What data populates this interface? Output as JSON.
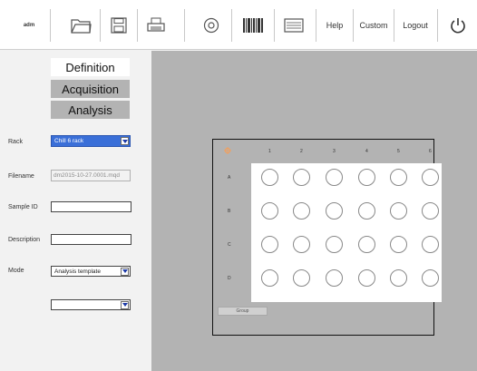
{
  "toolbar": {
    "user": "adm",
    "help_label": "Help",
    "custom_label": "Custom",
    "logout_label": "Logout",
    "icons": [
      "open-folder-icon",
      "save-icon",
      "print-icon",
      "target-icon",
      "barcode-icon",
      "keyboard-icon",
      "power-icon"
    ]
  },
  "steps": {
    "definition": "Definition",
    "acquisition": "Acquisition",
    "analysis": "Analysis",
    "active": "definition"
  },
  "form": {
    "rack_label": "Rack",
    "rack_value": "Chill 6 rack",
    "filename_label": "Filename",
    "filename_value": "dm2015-10-27.0001.mqd",
    "sample_id_label": "Sample ID",
    "sample_id_value": "",
    "description_label": "Description",
    "description_value": "",
    "mode_label": "Mode",
    "mode_value": "Analysis template",
    "extra_value": ""
  },
  "rack": {
    "columns": [
      "1",
      "2",
      "3",
      "4",
      "5",
      "6"
    ],
    "rows": [
      "A",
      "B",
      "C",
      "D"
    ],
    "group_label": "Group"
  },
  "colors": {
    "accent_select": "#3a6fd8",
    "workspace_bg": "#b3b3b3",
    "panel_bg": "#f2f2f2",
    "corner_icon": "#f0a060"
  }
}
